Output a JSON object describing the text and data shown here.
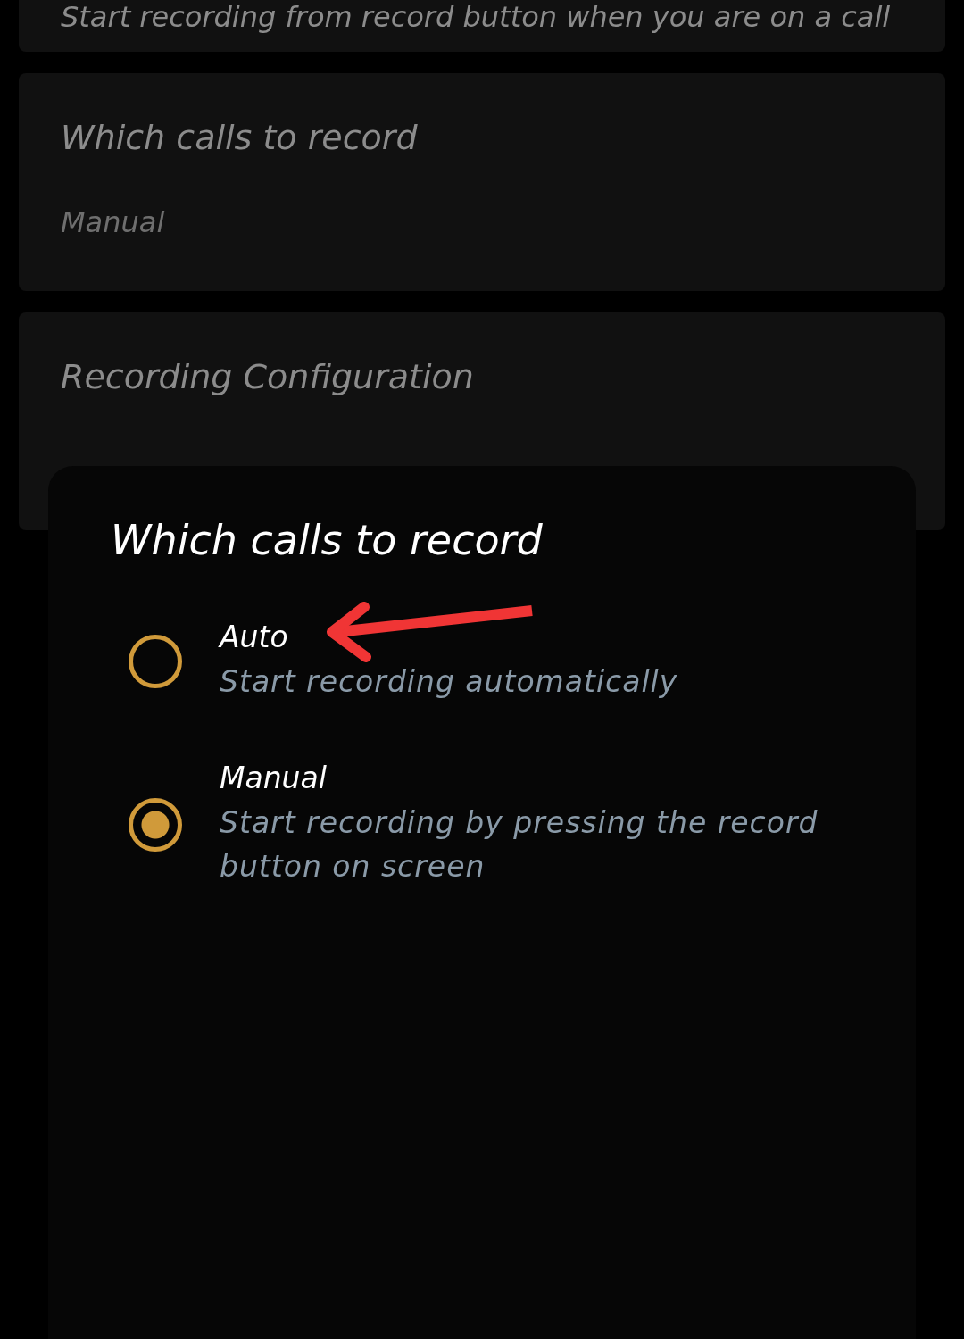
{
  "settings": [
    {
      "title": "Start recording from record button when you are on a call"
    },
    {
      "title": "Which calls to record",
      "summary": "Manual"
    },
    {
      "title": "Recording Configuration"
    }
  ],
  "dialog": {
    "title": "Which calls to record",
    "options": [
      {
        "label": "Auto",
        "description": "Start recording automatically",
        "selected": false
      },
      {
        "label": "Manual",
        "description": "Start recording by pressing the record button on screen",
        "selected": true
      }
    ]
  }
}
